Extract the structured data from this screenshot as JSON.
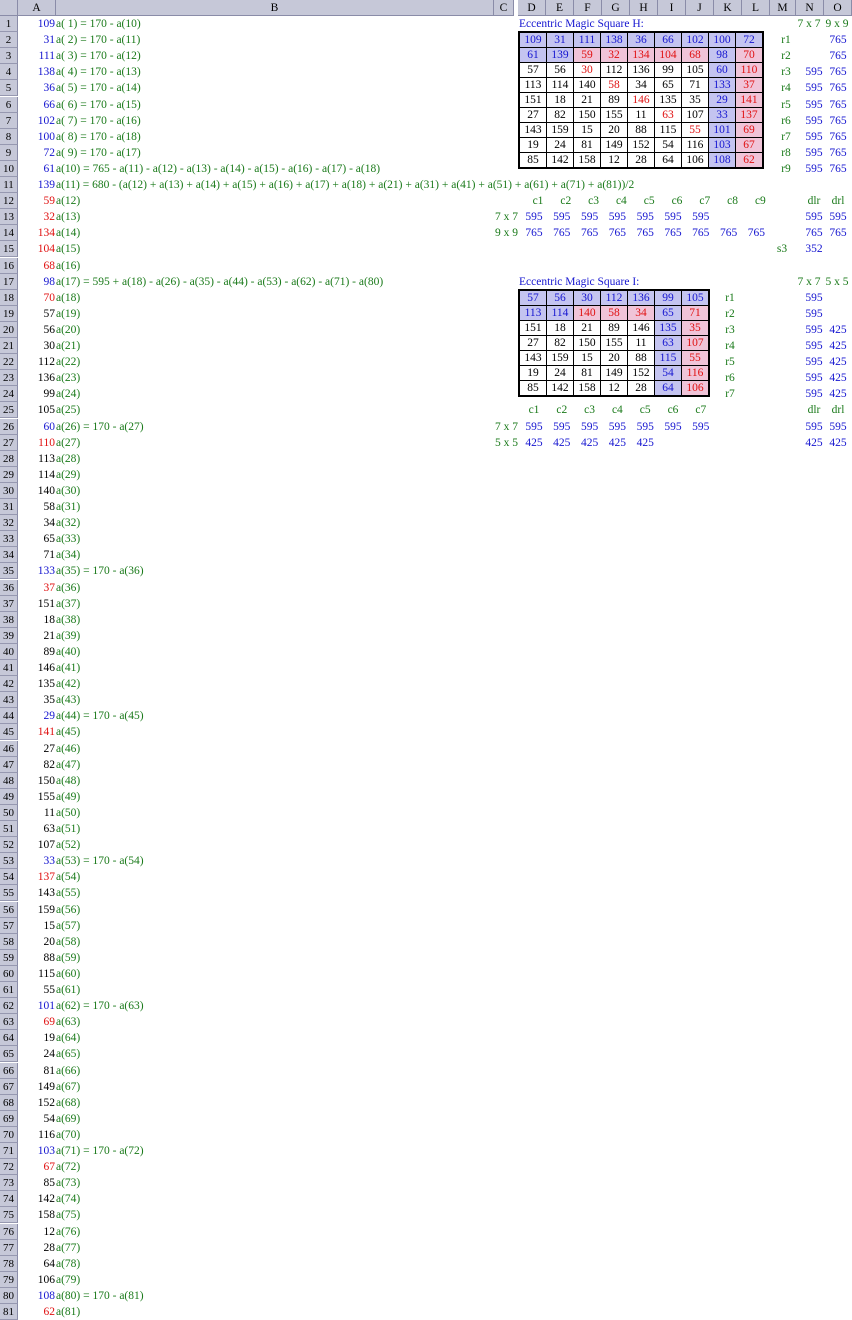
{
  "columns": [
    "A",
    "B",
    "C",
    "D",
    "E",
    "F",
    "G",
    "H",
    "I",
    "J",
    "K",
    "L",
    "M",
    "N",
    "O"
  ],
  "rows": [
    {
      "n": 1,
      "v": "109",
      "c": "blue",
      "f": "a( 1) = 170 - a(10)"
    },
    {
      "n": 2,
      "v": "31",
      "c": "blue",
      "f": "a( 2) = 170 - a(11)"
    },
    {
      "n": 3,
      "v": "111",
      "c": "blue",
      "f": "a( 3) = 170 - a(12)"
    },
    {
      "n": 4,
      "v": "138",
      "c": "blue",
      "f": "a( 4) = 170 - a(13)"
    },
    {
      "n": 5,
      "v": "36",
      "c": "blue",
      "f": "a( 5) = 170 - a(14)"
    },
    {
      "n": 6,
      "v": "66",
      "c": "blue",
      "f": "a( 6) = 170 - a(15)"
    },
    {
      "n": 7,
      "v": "102",
      "c": "blue",
      "f": "a( 7) = 170 - a(16)"
    },
    {
      "n": 8,
      "v": "100",
      "c": "blue",
      "f": "a( 8) = 170 - a(18)"
    },
    {
      "n": 9,
      "v": "72",
      "c": "blue",
      "f": "a( 9) = 170 - a(17)"
    },
    {
      "n": 10,
      "v": "61",
      "c": "blue",
      "f": "a(10) = 765 - a(11) - a(12) - a(13) - a(14) - a(15) - a(16) - a(17) - a(18)"
    },
    {
      "n": 11,
      "v": "139",
      "c": "blue",
      "f": "a(11) = 680 - (a(12) + a(13) + a(14) + a(15) + a(16) + a(17) + a(18) + a(21) + a(31) + a(41) + a(51) + a(61) + a(71) + a(81))/2"
    },
    {
      "n": 12,
      "v": "59",
      "c": "red",
      "f": "a(12)"
    },
    {
      "n": 13,
      "v": "32",
      "c": "red",
      "f": "a(13)"
    },
    {
      "n": 14,
      "v": "134",
      "c": "red",
      "f": "a(14)"
    },
    {
      "n": 15,
      "v": "104",
      "c": "red",
      "f": "a(15)"
    },
    {
      "n": 16,
      "v": "68",
      "c": "red",
      "f": "a(16)"
    },
    {
      "n": 17,
      "v": "98",
      "c": "blue",
      "f": "a(17) = 595 + a(18) - a(26) - a(35) - a(44) - a(53) - a(62) - a(71) - a(80)"
    },
    {
      "n": 18,
      "v": "70",
      "c": "red",
      "f": "a(18)"
    },
    {
      "n": 19,
      "v": "57",
      "c": "black",
      "f": "a(19)"
    },
    {
      "n": 20,
      "v": "56",
      "c": "black",
      "f": "a(20)"
    },
    {
      "n": 21,
      "v": "30",
      "c": "black",
      "f": "a(21)"
    },
    {
      "n": 22,
      "v": "112",
      "c": "black",
      "f": "a(22)"
    },
    {
      "n": 23,
      "v": "136",
      "c": "black",
      "f": "a(23)"
    },
    {
      "n": 24,
      "v": "99",
      "c": "black",
      "f": "a(24)"
    },
    {
      "n": 25,
      "v": "105",
      "c": "black",
      "f": "a(25)"
    },
    {
      "n": 26,
      "v": "60",
      "c": "blue",
      "f": "a(26) = 170 - a(27)"
    },
    {
      "n": 27,
      "v": "110",
      "c": "red",
      "f": "a(27)"
    },
    {
      "n": 28,
      "v": "113",
      "c": "black",
      "f": "a(28)"
    },
    {
      "n": 29,
      "v": "114",
      "c": "black",
      "f": "a(29)"
    },
    {
      "n": 30,
      "v": "140",
      "c": "black",
      "f": "a(30)"
    },
    {
      "n": 31,
      "v": "58",
      "c": "black",
      "f": "a(31)"
    },
    {
      "n": 32,
      "v": "34",
      "c": "black",
      "f": "a(32)"
    },
    {
      "n": 33,
      "v": "65",
      "c": "black",
      "f": "a(33)"
    },
    {
      "n": 34,
      "v": "71",
      "c": "black",
      "f": "a(34)"
    },
    {
      "n": 35,
      "v": "133",
      "c": "blue",
      "f": "a(35) = 170 - a(36)"
    },
    {
      "n": 36,
      "v": "37",
      "c": "red",
      "f": "a(36)"
    },
    {
      "n": 37,
      "v": "151",
      "c": "black",
      "f": "a(37)"
    },
    {
      "n": 38,
      "v": "18",
      "c": "black",
      "f": "a(38)"
    },
    {
      "n": 39,
      "v": "21",
      "c": "black",
      "f": "a(39)"
    },
    {
      "n": 40,
      "v": "89",
      "c": "black",
      "f": "a(40)"
    },
    {
      "n": 41,
      "v": "146",
      "c": "black",
      "f": "a(41)"
    },
    {
      "n": 42,
      "v": "135",
      "c": "black",
      "f": "a(42)"
    },
    {
      "n": 43,
      "v": "35",
      "c": "black",
      "f": "a(43)"
    },
    {
      "n": 44,
      "v": "29",
      "c": "blue",
      "f": "a(44) = 170 - a(45)"
    },
    {
      "n": 45,
      "v": "141",
      "c": "red",
      "f": "a(45)"
    },
    {
      "n": 46,
      "v": "27",
      "c": "black",
      "f": "a(46)"
    },
    {
      "n": 47,
      "v": "82",
      "c": "black",
      "f": "a(47)"
    },
    {
      "n": 48,
      "v": "150",
      "c": "black",
      "f": "a(48)"
    },
    {
      "n": 49,
      "v": "155",
      "c": "black",
      "f": "a(49)"
    },
    {
      "n": 50,
      "v": "11",
      "c": "black",
      "f": "a(50)"
    },
    {
      "n": 51,
      "v": "63",
      "c": "black",
      "f": "a(51)"
    },
    {
      "n": 52,
      "v": "107",
      "c": "black",
      "f": "a(52)"
    },
    {
      "n": 53,
      "v": "33",
      "c": "blue",
      "f": "a(53) = 170 - a(54)"
    },
    {
      "n": 54,
      "v": "137",
      "c": "red",
      "f": "a(54)"
    },
    {
      "n": 55,
      "v": "143",
      "c": "black",
      "f": "a(55)"
    },
    {
      "n": 56,
      "v": "159",
      "c": "black",
      "f": "a(56)"
    },
    {
      "n": 57,
      "v": "15",
      "c": "black",
      "f": "a(57)"
    },
    {
      "n": 58,
      "v": "20",
      "c": "black",
      "f": "a(58)"
    },
    {
      "n": 59,
      "v": "88",
      "c": "black",
      "f": "a(59)"
    },
    {
      "n": 60,
      "v": "115",
      "c": "black",
      "f": "a(60)"
    },
    {
      "n": 61,
      "v": "55",
      "c": "black",
      "f": "a(61)"
    },
    {
      "n": 62,
      "v": "101",
      "c": "blue",
      "f": "a(62) = 170 - a(63)"
    },
    {
      "n": 63,
      "v": "69",
      "c": "red",
      "f": "a(63)"
    },
    {
      "n": 64,
      "v": "19",
      "c": "black",
      "f": "a(64)"
    },
    {
      "n": 65,
      "v": "24",
      "c": "black",
      "f": "a(65)"
    },
    {
      "n": 66,
      "v": "81",
      "c": "black",
      "f": "a(66)"
    },
    {
      "n": 67,
      "v": "149",
      "c": "black",
      "f": "a(67)"
    },
    {
      "n": 68,
      "v": "152",
      "c": "black",
      "f": "a(68)"
    },
    {
      "n": 69,
      "v": "54",
      "c": "black",
      "f": "a(69)"
    },
    {
      "n": 70,
      "v": "116",
      "c": "black",
      "f": "a(70)"
    },
    {
      "n": 71,
      "v": "103",
      "c": "blue",
      "f": "a(71) = 170 - a(72)"
    },
    {
      "n": 72,
      "v": "67",
      "c": "red",
      "f": "a(72)"
    },
    {
      "n": 73,
      "v": "85",
      "c": "black",
      "f": "a(73)"
    },
    {
      "n": 74,
      "v": "142",
      "c": "black",
      "f": "a(74)"
    },
    {
      "n": 75,
      "v": "158",
      "c": "black",
      "f": "a(75)"
    },
    {
      "n": 76,
      "v": "12",
      "c": "black",
      "f": "a(76)"
    },
    {
      "n": 77,
      "v": "28",
      "c": "black",
      "f": "a(77)"
    },
    {
      "n": 78,
      "v": "64",
      "c": "black",
      "f": "a(78)"
    },
    {
      "n": 79,
      "v": "106",
      "c": "black",
      "f": "a(79)"
    },
    {
      "n": 80,
      "v": "108",
      "c": "blue",
      "f": "a(80) = 170 - a(81)"
    },
    {
      "n": 81,
      "v": "62",
      "c": "red",
      "f": "a(81)"
    }
  ],
  "squareH": {
    "title": "Eccentric Magic Square H:",
    "size_label_7": "7 x 7",
    "size_label_9": "9 x 9",
    "cells": [
      [
        [
          "109",
          "blue",
          "B"
        ],
        [
          "31",
          "blue",
          "B"
        ],
        [
          "111",
          "blue",
          "B"
        ],
        [
          "138",
          "blue",
          "B"
        ],
        [
          "36",
          "blue",
          "B"
        ],
        [
          "66",
          "blue",
          "B"
        ],
        [
          "102",
          "blue",
          "B"
        ],
        [
          "100",
          "blue",
          "B"
        ],
        [
          "72",
          "blue",
          "B"
        ]
      ],
      [
        [
          "61",
          "blue",
          "B"
        ],
        [
          "139",
          "blue",
          "B"
        ],
        [
          "59",
          "red",
          "R"
        ],
        [
          "32",
          "red",
          "R"
        ],
        [
          "134",
          "red",
          "R"
        ],
        [
          "104",
          "red",
          "R"
        ],
        [
          "68",
          "red",
          "R"
        ],
        [
          "98",
          "blue",
          "B"
        ],
        [
          "70",
          "red",
          "R"
        ]
      ],
      [
        [
          "57",
          "black",
          "W"
        ],
        [
          "56",
          "black",
          "W"
        ],
        [
          "30",
          "red",
          "W"
        ],
        [
          "112",
          "black",
          "W"
        ],
        [
          "136",
          "black",
          "W"
        ],
        [
          "99",
          "black",
          "W"
        ],
        [
          "105",
          "black",
          "W"
        ],
        [
          "60",
          "blue",
          "B"
        ],
        [
          "110",
          "red",
          "R"
        ]
      ],
      [
        [
          "113",
          "black",
          "W"
        ],
        [
          "114",
          "black",
          "W"
        ],
        [
          "140",
          "black",
          "W"
        ],
        [
          "58",
          "red",
          "W"
        ],
        [
          "34",
          "black",
          "W"
        ],
        [
          "65",
          "black",
          "W"
        ],
        [
          "71",
          "black",
          "W"
        ],
        [
          "133",
          "blue",
          "B"
        ],
        [
          "37",
          "red",
          "R"
        ]
      ],
      [
        [
          "151",
          "black",
          "W"
        ],
        [
          "18",
          "black",
          "W"
        ],
        [
          "21",
          "black",
          "W"
        ],
        [
          "89",
          "black",
          "W"
        ],
        [
          "146",
          "red",
          "W"
        ],
        [
          "135",
          "black",
          "W"
        ],
        [
          "35",
          "black",
          "W"
        ],
        [
          "29",
          "blue",
          "B"
        ],
        [
          "141",
          "red",
          "R"
        ]
      ],
      [
        [
          "27",
          "black",
          "W"
        ],
        [
          "82",
          "black",
          "W"
        ],
        [
          "150",
          "black",
          "W"
        ],
        [
          "155",
          "black",
          "W"
        ],
        [
          "11",
          "black",
          "W"
        ],
        [
          "63",
          "red",
          "W"
        ],
        [
          "107",
          "black",
          "W"
        ],
        [
          "33",
          "blue",
          "B"
        ],
        [
          "137",
          "red",
          "R"
        ]
      ],
      [
        [
          "143",
          "black",
          "W"
        ],
        [
          "159",
          "black",
          "W"
        ],
        [
          "15",
          "black",
          "W"
        ],
        [
          "20",
          "black",
          "W"
        ],
        [
          "88",
          "black",
          "W"
        ],
        [
          "115",
          "black",
          "W"
        ],
        [
          "55",
          "red",
          "W"
        ],
        [
          "101",
          "blue",
          "B"
        ],
        [
          "69",
          "red",
          "R"
        ]
      ],
      [
        [
          "19",
          "black",
          "W"
        ],
        [
          "24",
          "black",
          "W"
        ],
        [
          "81",
          "black",
          "W"
        ],
        [
          "149",
          "black",
          "W"
        ],
        [
          "152",
          "black",
          "W"
        ],
        [
          "54",
          "black",
          "W"
        ],
        [
          "116",
          "black",
          "W"
        ],
        [
          "103",
          "blue",
          "B"
        ],
        [
          "67",
          "red",
          "R"
        ]
      ],
      [
        [
          "85",
          "black",
          "W"
        ],
        [
          "142",
          "black",
          "W"
        ],
        [
          "158",
          "black",
          "W"
        ],
        [
          "12",
          "black",
          "W"
        ],
        [
          "28",
          "black",
          "W"
        ],
        [
          "64",
          "black",
          "W"
        ],
        [
          "106",
          "black",
          "W"
        ],
        [
          "108",
          "blue",
          "B"
        ],
        [
          "62",
          "red",
          "R"
        ]
      ]
    ],
    "row_labels": [
      "r1",
      "r2",
      "r3",
      "r4",
      "r5",
      "r6",
      "r7",
      "r8",
      "r9"
    ],
    "row_sums_7": [
      "",
      "",
      "595",
      "595",
      "595",
      "595",
      "595",
      "595",
      "595"
    ],
    "row_sums_9": [
      "765",
      "765",
      "765",
      "765",
      "765",
      "765",
      "765",
      "765",
      "765"
    ],
    "col_labels": [
      "c1",
      "c2",
      "c3",
      "c4",
      "c5",
      "c6",
      "c7",
      "c8",
      "c9"
    ],
    "diag_labels": [
      "dlr",
      "drl"
    ],
    "sum_label_7": "7 x 7",
    "sum_label_9": "9 x 9",
    "col_sums_7": [
      "595",
      "595",
      "595",
      "595",
      "595",
      "595",
      "595"
    ],
    "col_sums_9": [
      "765",
      "765",
      "765",
      "765",
      "765",
      "765",
      "765",
      "765",
      "765"
    ],
    "diag_sums_7": [
      "595",
      "595"
    ],
    "diag_sums_9": [
      "765",
      "765"
    ],
    "s3_label": "s3",
    "s3_value": "352"
  },
  "squareI": {
    "title": "Eccentric Magic Square I:",
    "size_label_7": "7 x 7",
    "size_label_5": "5 x 5",
    "cells": [
      [
        [
          "57",
          "blue",
          "B"
        ],
        [
          "56",
          "blue",
          "B"
        ],
        [
          "30",
          "blue",
          "B"
        ],
        [
          "112",
          "blue",
          "B"
        ],
        [
          "136",
          "blue",
          "B"
        ],
        [
          "99",
          "blue",
          "B"
        ],
        [
          "105",
          "blue",
          "B"
        ]
      ],
      [
        [
          "113",
          "blue",
          "B"
        ],
        [
          "114",
          "blue",
          "B"
        ],
        [
          "140",
          "red",
          "R"
        ],
        [
          "58",
          "red",
          "R"
        ],
        [
          "34",
          "red",
          "R"
        ],
        [
          "65",
          "blue",
          "B"
        ],
        [
          "71",
          "red",
          "R"
        ]
      ],
      [
        [
          "151",
          "black",
          "W"
        ],
        [
          "18",
          "black",
          "W"
        ],
        [
          "21",
          "black",
          "W"
        ],
        [
          "89",
          "black",
          "W"
        ],
        [
          "146",
          "black",
          "W"
        ],
        [
          "135",
          "blue",
          "B"
        ],
        [
          "35",
          "red",
          "R"
        ]
      ],
      [
        [
          "27",
          "black",
          "W"
        ],
        [
          "82",
          "black",
          "W"
        ],
        [
          "150",
          "black",
          "W"
        ],
        [
          "155",
          "black",
          "W"
        ],
        [
          "11",
          "black",
          "W"
        ],
        [
          "63",
          "blue",
          "B"
        ],
        [
          "107",
          "red",
          "R"
        ]
      ],
      [
        [
          "143",
          "black",
          "W"
        ],
        [
          "159",
          "black",
          "W"
        ],
        [
          "15",
          "black",
          "W"
        ],
        [
          "20",
          "black",
          "W"
        ],
        [
          "88",
          "black",
          "W"
        ],
        [
          "115",
          "blue",
          "B"
        ],
        [
          "55",
          "red",
          "R"
        ]
      ],
      [
        [
          "19",
          "black",
          "W"
        ],
        [
          "24",
          "black",
          "W"
        ],
        [
          "81",
          "black",
          "W"
        ],
        [
          "149",
          "black",
          "W"
        ],
        [
          "152",
          "black",
          "W"
        ],
        [
          "54",
          "blue",
          "B"
        ],
        [
          "116",
          "red",
          "R"
        ]
      ],
      [
        [
          "85",
          "black",
          "W"
        ],
        [
          "142",
          "black",
          "W"
        ],
        [
          "158",
          "black",
          "W"
        ],
        [
          "12",
          "black",
          "W"
        ],
        [
          "28",
          "black",
          "W"
        ],
        [
          "64",
          "blue",
          "B"
        ],
        [
          "106",
          "red",
          "R"
        ]
      ]
    ],
    "row_labels": [
      "r1",
      "r2",
      "r3",
      "r4",
      "r5",
      "r6",
      "r7"
    ],
    "row_sums_7": [
      "595",
      "595",
      "595",
      "595",
      "595",
      "595",
      "595"
    ],
    "row_sums_5": [
      "",
      "",
      "425",
      "425",
      "425",
      "425",
      "425"
    ],
    "col_labels": [
      "c1",
      "c2",
      "c3",
      "c4",
      "c5",
      "c6",
      "c7"
    ],
    "diag_labels": [
      "dlr",
      "drl"
    ],
    "sum_label_7": "7 x 7",
    "sum_label_5": "5 x 5",
    "col_sums_7": [
      "595",
      "595",
      "595",
      "595",
      "595",
      "595",
      "595"
    ],
    "col_sums_5": [
      "425",
      "425",
      "425",
      "425",
      "425"
    ],
    "diag_sums_7": [
      "595",
      "595"
    ],
    "diag_sums_5": [
      "425",
      "425"
    ]
  }
}
